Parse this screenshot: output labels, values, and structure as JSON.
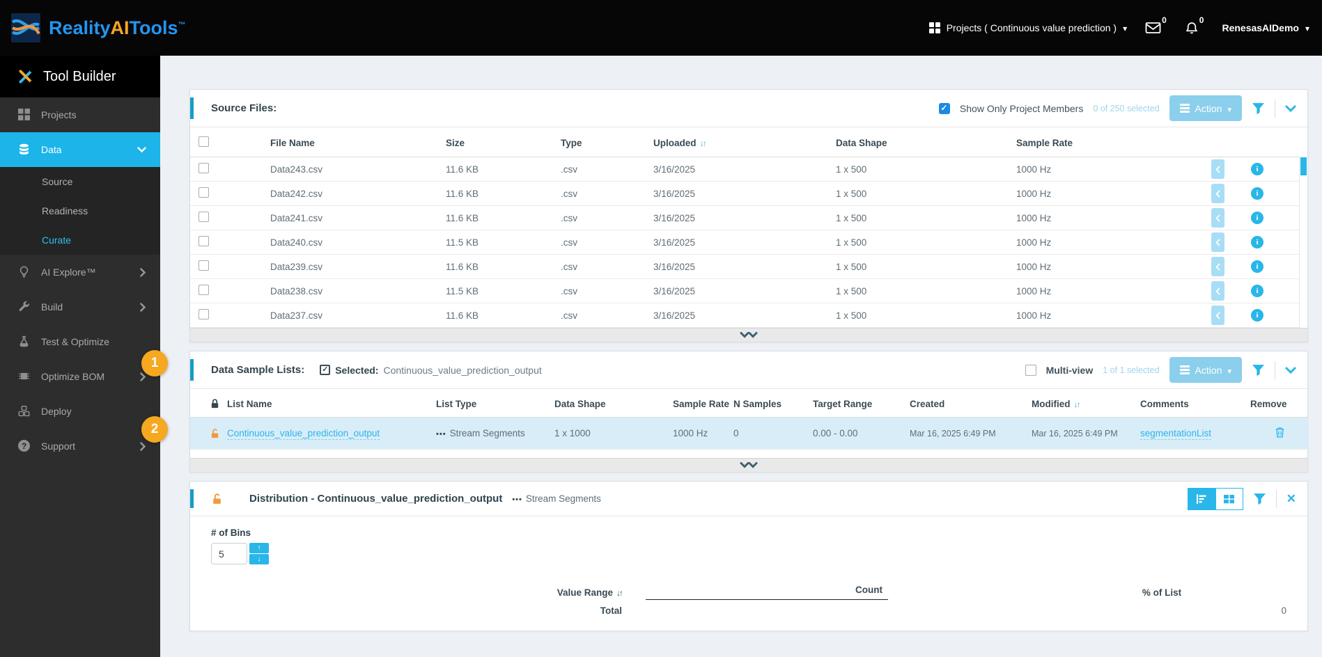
{
  "topbar": {
    "brand": {
      "reality": "Reality",
      "ai": "AI",
      "tools": "Tools",
      "tm": "™"
    },
    "projects_menu": "Projects ( Continuous value prediction )",
    "mail_count": "0",
    "bell_count": "0",
    "user": "RenesasAIDemo"
  },
  "sidebar": {
    "tool_builder": "Tool Builder",
    "items": [
      {
        "label": "Projects"
      },
      {
        "label": "Data"
      },
      {
        "label": "AI Explore™"
      },
      {
        "label": "Build"
      },
      {
        "label": "Test & Optimize"
      },
      {
        "label": "Optimize BOM"
      },
      {
        "label": "Deploy"
      },
      {
        "label": "Support"
      }
    ],
    "data_children": [
      {
        "label": "Source"
      },
      {
        "label": "Readiness"
      },
      {
        "label": "Curate"
      }
    ]
  },
  "callouts": {
    "one": "1",
    "two": "2"
  },
  "source_files": {
    "title": "Source Files:",
    "show_only_label": "Show Only Project Members",
    "selected_count": "0 of 250 selected",
    "action_label": "Action",
    "columns": {
      "file_name": "File Name",
      "size": "Size",
      "type": "Type",
      "uploaded": "Uploaded",
      "data_shape": "Data Shape",
      "sample_rate": "Sample Rate"
    },
    "rows": [
      {
        "name": "Data243.csv",
        "size": "11.6 KB",
        "type": ".csv",
        "uploaded": "3/16/2025",
        "shape": "1 x 500",
        "rate": "1000 Hz"
      },
      {
        "name": "Data242.csv",
        "size": "11.6 KB",
        "type": ".csv",
        "uploaded": "3/16/2025",
        "shape": "1 x 500",
        "rate": "1000 Hz"
      },
      {
        "name": "Data241.csv",
        "size": "11.6 KB",
        "type": ".csv",
        "uploaded": "3/16/2025",
        "shape": "1 x 500",
        "rate": "1000 Hz"
      },
      {
        "name": "Data240.csv",
        "size": "11.5 KB",
        "type": ".csv",
        "uploaded": "3/16/2025",
        "shape": "1 x 500",
        "rate": "1000 Hz"
      },
      {
        "name": "Data239.csv",
        "size": "11.6 KB",
        "type": ".csv",
        "uploaded": "3/16/2025",
        "shape": "1 x 500",
        "rate": "1000 Hz"
      },
      {
        "name": "Data238.csv",
        "size": "11.5 KB",
        "type": ".csv",
        "uploaded": "3/16/2025",
        "shape": "1 x 500",
        "rate": "1000 Hz"
      },
      {
        "name": "Data237.csv",
        "size": "11.6 KB",
        "type": ".csv",
        "uploaded": "3/16/2025",
        "shape": "1 x 500",
        "rate": "1000 Hz"
      }
    ]
  },
  "sample_lists": {
    "title": "Data Sample Lists:",
    "selected_label": "Selected:",
    "selected_value": "Continuous_value_prediction_output",
    "multi_view_label": "Multi-view",
    "selected_count": "1 of 1 selected",
    "action_label": "Action",
    "columns": {
      "list_name": "List Name",
      "list_type": "List Type",
      "data_shape": "Data Shape",
      "sample_rate": "Sample Rate",
      "n_samples": "N Samples",
      "target_range": "Target Range",
      "created": "Created",
      "modified": "Modified",
      "comments": "Comments",
      "remove": "Remove"
    },
    "row": {
      "name": "Continuous_value_prediction_output",
      "type_dots": "•••",
      "type": "Stream Segments",
      "shape": "1 x 1000",
      "rate": "1000 Hz",
      "n_samples": "0",
      "target_range": "0.00 - 0.00",
      "created": "Mar 16, 2025 6:49 PM",
      "modified": "Mar 16, 2025 6:49 PM",
      "comments": "segmentationList"
    }
  },
  "distribution": {
    "title": "Distribution - Continuous_value_prediction_output",
    "type_dots": "•••",
    "subtype": "Stream Segments",
    "bins_label": "# of Bins",
    "bins_value": "5",
    "columns": {
      "value_range": "Value Range",
      "count": "Count",
      "pct": "% of List"
    },
    "total_label": "Total",
    "total_value": "0"
  },
  "colors": {
    "accent_bar": "#1a9dc3",
    "cyan": "#29b6e8",
    "sidebar_active": "#1cb4e9",
    "orange": "#f6a821",
    "selected_row": "#d9edf8",
    "action_button": "#8bcfec",
    "blue_checkbox": "#1e88e5"
  }
}
